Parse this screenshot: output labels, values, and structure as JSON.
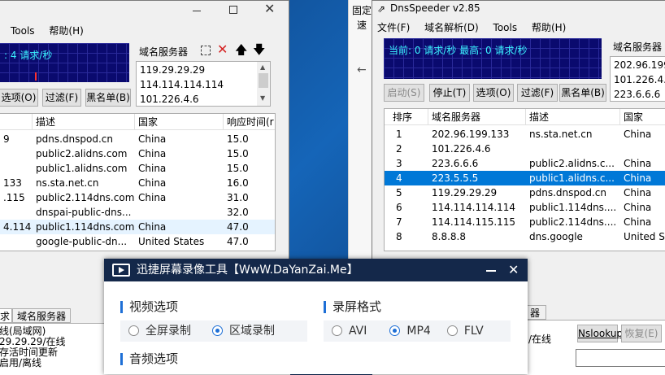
{
  "left_window": {
    "menu": [
      "Tools",
      "帮助(H)"
    ],
    "graph_text": ": 4 请求/秒",
    "dns_label": "域名服务器",
    "dns_list": [
      "119.29.29.29",
      "114.114.114.114",
      "101.226.4.6"
    ],
    "buttons": [
      "选项(O)",
      "过滤(F)",
      "黑名单(B)"
    ],
    "columns": [
      "描述",
      "国家",
      "响应时间(r"
    ],
    "rows": [
      {
        "ip": "9",
        "desc": "pdns.dnspod.cn",
        "country": "China",
        "time": "15.0"
      },
      {
        "ip": "",
        "desc": "public2.alidns.com",
        "country": "China",
        "time": "15.0"
      },
      {
        "ip": "",
        "desc": "public1.alidns.com",
        "country": "China",
        "time": "15.0"
      },
      {
        "ip": "133",
        "desc": "ns.sta.net.cn",
        "country": "China",
        "time": "16.0"
      },
      {
        "ip": ".115",
        "desc": "public2.114dns.com",
        "country": "China",
        "time": "31.0"
      },
      {
        "ip": "",
        "desc": "dnspai-public-dns...",
        "country": "",
        "time": "32.0"
      },
      {
        "ip": "4.114",
        "desc": "public1.114dns.com",
        "country": "China",
        "time": "47.0"
      },
      {
        "ip": "",
        "desc": "google-public-dn...",
        "country": "United States",
        "time": "47.0"
      }
    ],
    "bottom_tabs": [
      "求",
      "域名服务器"
    ],
    "log": [
      "线(局域网)",
      "29.29.29/在线",
      "存活时间更新",
      "启用/离线"
    ]
  },
  "right_window": {
    "behind_texts": [
      "固定",
      "速"
    ],
    "title": "DnsSpeeder v2.85",
    "menu": [
      "文件(F)",
      "域名解析(D)",
      "Tools",
      "帮助(H)"
    ],
    "graph_text": "当前: 0 请求/秒 最高: 0 请求/秒",
    "dns_label": "域名服务器",
    "dns_list": [
      "202.96.199.1",
      "101.226.4.6",
      "223.6.6.6"
    ],
    "buttons": [
      "启动(S)",
      "停止(T)",
      "选项(O)",
      "过滤(F)",
      "黑名单(B)"
    ],
    "columns": [
      "排序",
      "域名服务器",
      "描述",
      "国家"
    ],
    "rows": [
      {
        "n": "1",
        "ip": "202.96.199.133",
        "desc": "ns.sta.net.cn",
        "country": "China"
      },
      {
        "n": "2",
        "ip": "101.226.4.6",
        "desc": "",
        "country": ""
      },
      {
        "n": "3",
        "ip": "223.6.6.6",
        "desc": "public2.alidns.c...",
        "country": "China"
      },
      {
        "n": "4",
        "ip": "223.5.5.5",
        "desc": "public1.alidns.c...",
        "country": "China"
      },
      {
        "n": "5",
        "ip": "119.29.29.29",
        "desc": "pdns.dnspod.cn",
        "country": "China"
      },
      {
        "n": "6",
        "ip": "114.114.114.114",
        "desc": "public1.114dns....",
        "country": "China"
      },
      {
        "n": "7",
        "ip": "114.114.115.115",
        "desc": "public2.114dns....",
        "country": "China"
      },
      {
        "n": "8",
        "ip": "8.8.8.8",
        "desc": "dns.google",
        "country": "United St"
      }
    ],
    "bottom_tab": "器",
    "log_status": "/在线",
    "nslookup": "Nslookup",
    "restore": "恢复(E)"
  },
  "recorder": {
    "title": "迅捷屏幕录像工具【WwW.DaYanZai.Me】",
    "video_section": "视频选项",
    "video_opts": [
      "全屏录制",
      "区域录制"
    ],
    "video_selected": 1,
    "format_section": "录屏格式",
    "format_opts": [
      "AVI",
      "MP4",
      "FLV"
    ],
    "format_selected": 1,
    "audio_section": "音频选项"
  },
  "colors": {
    "graph_bg": "#0a0a6e",
    "graph_text": "#3af3ff",
    "select": "#0078d7",
    "recorder_title": "#14284a",
    "accent": "#1e6fd6"
  }
}
